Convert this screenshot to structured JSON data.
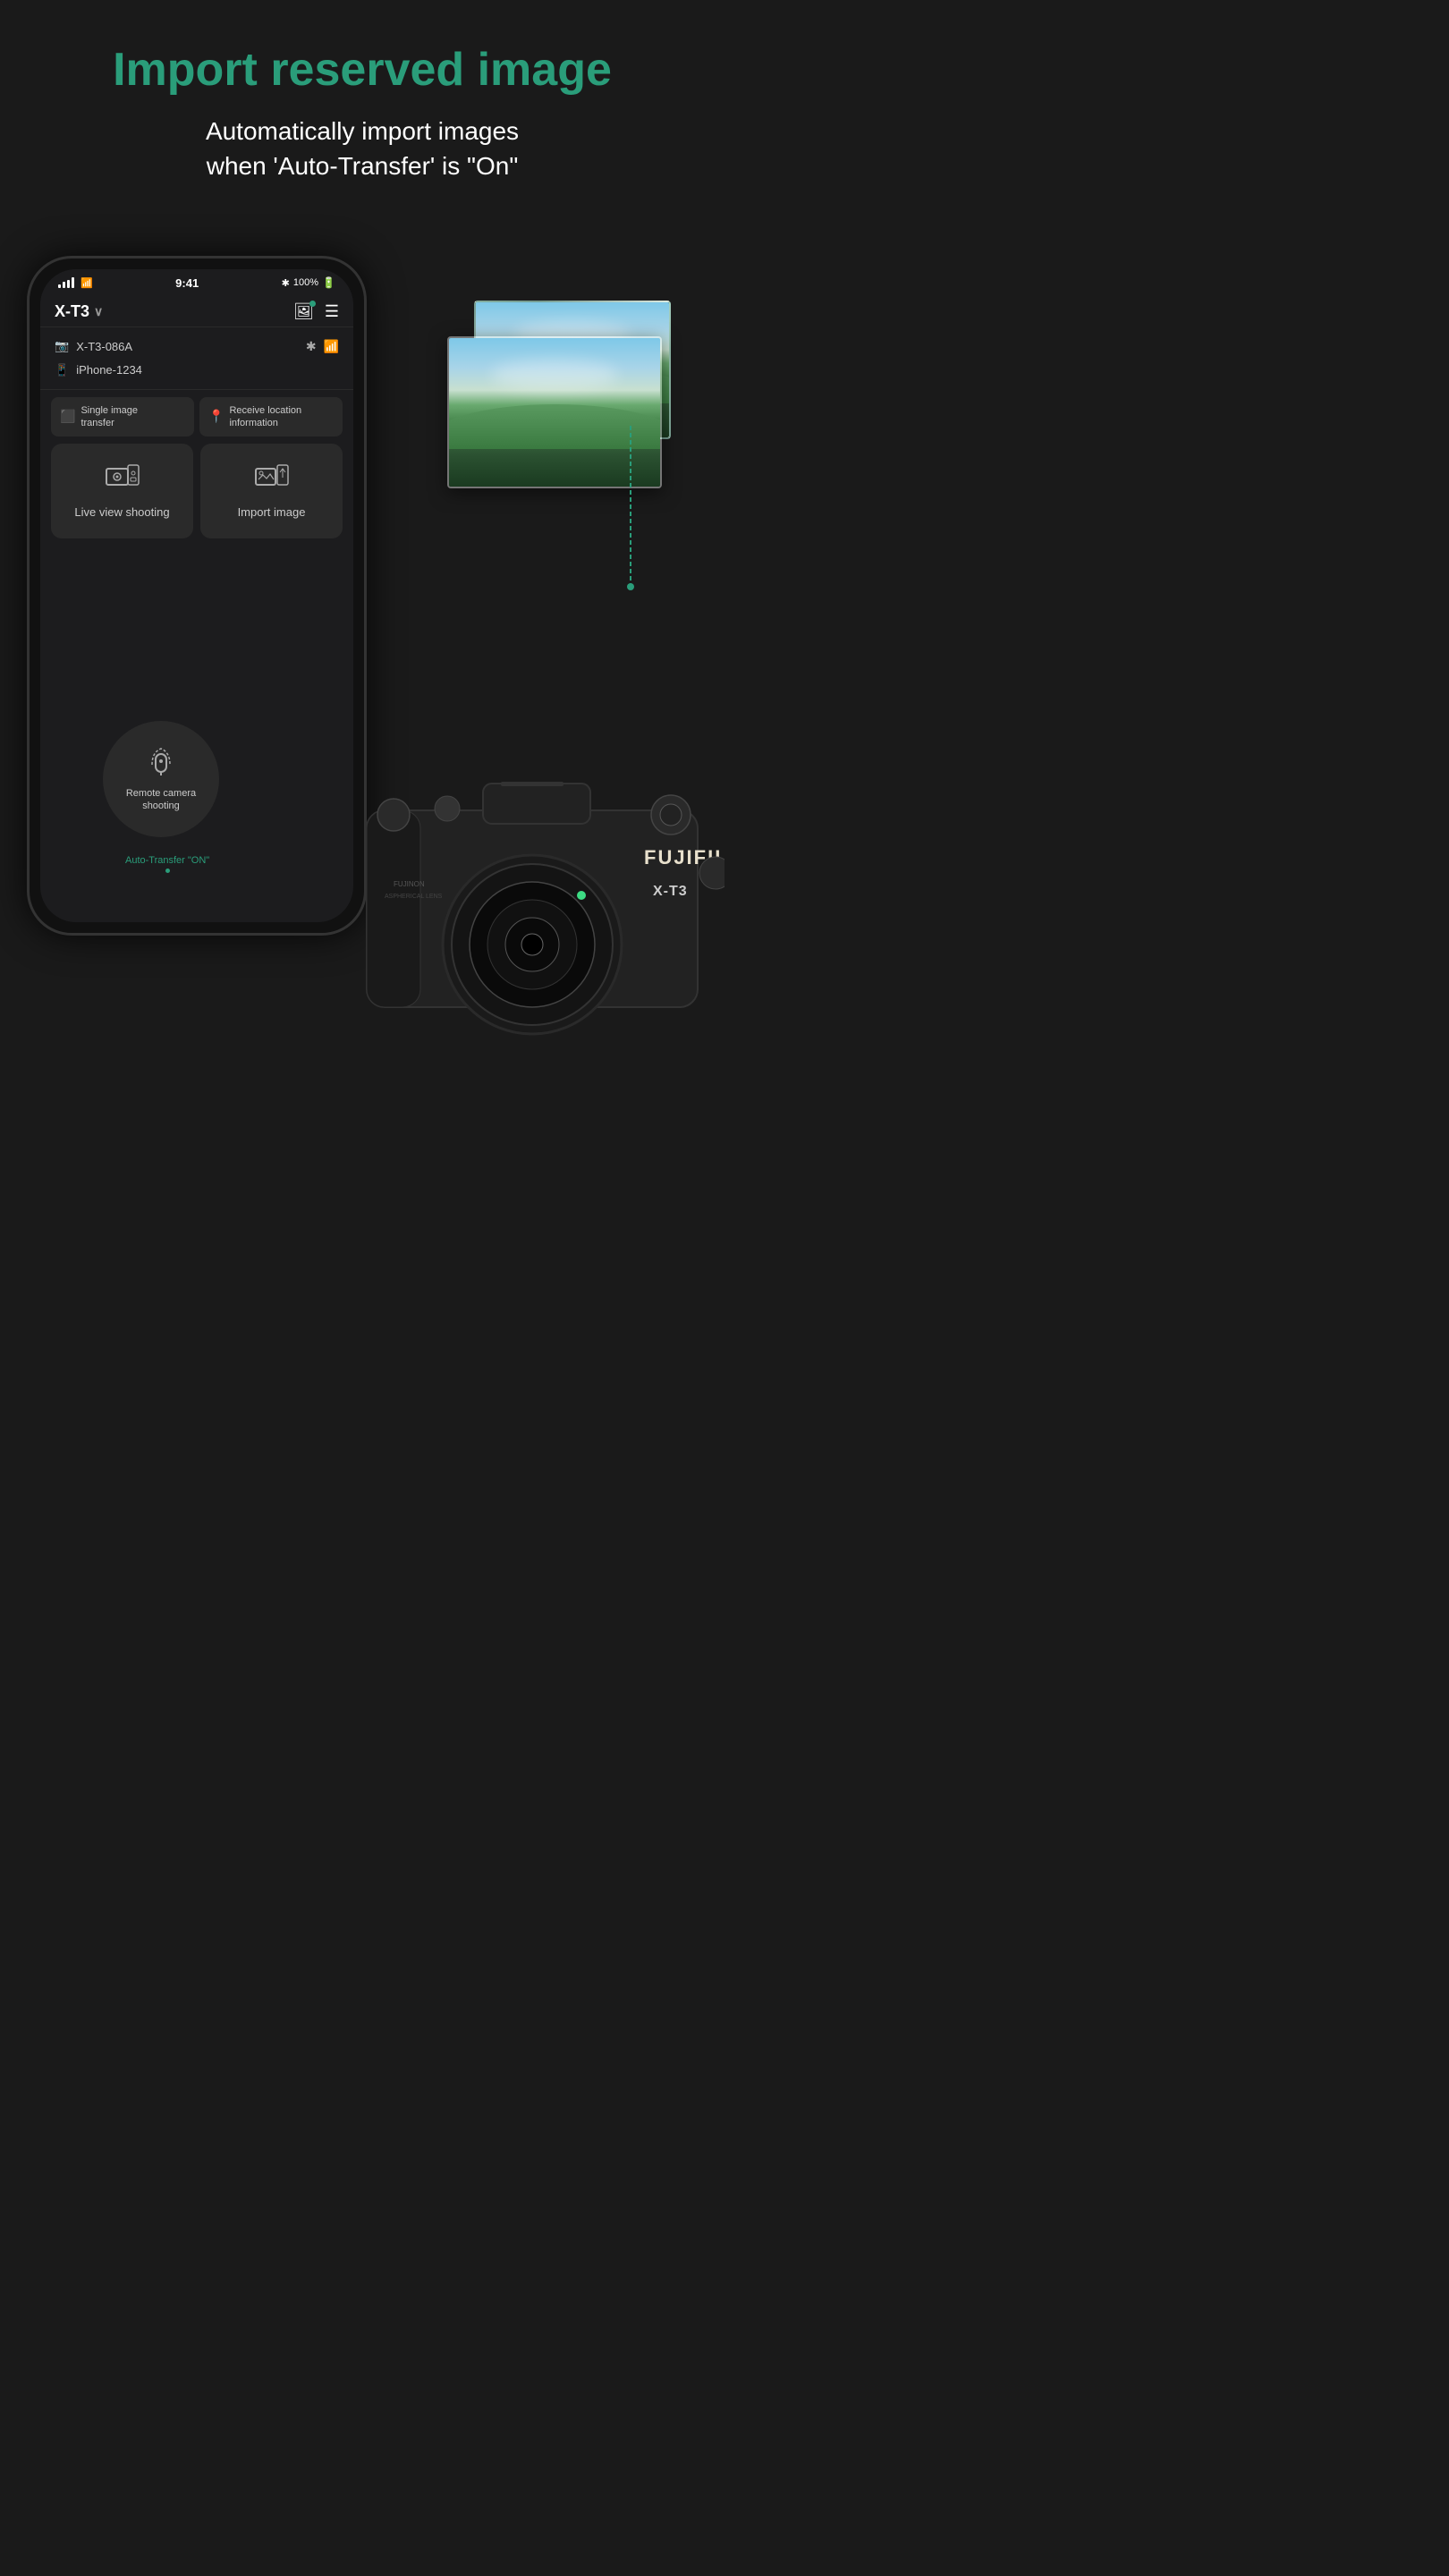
{
  "header": {
    "title": "Import reserved image",
    "subtitle_line1": "Automatically import images",
    "subtitle_line2": "when 'Auto-Transfer' is \"On\""
  },
  "phone": {
    "status_bar": {
      "time": "9:41",
      "battery": "100%",
      "bluetooth": "✱"
    },
    "app_header": {
      "camera_model": "X-T3",
      "chevron": "∨"
    },
    "devices": [
      {
        "icon": "📷",
        "name": "X-T3-086A"
      },
      {
        "icon": "📱",
        "name": "iPhone-1234"
      }
    ],
    "function_buttons": [
      {
        "icon": "⬜",
        "label_line1": "Single image",
        "label_line2": "transfer"
      },
      {
        "icon": "📍",
        "label_line1": "Receive location",
        "label_line2": "information"
      }
    ],
    "menu_items": [
      {
        "label": "Live view shooting"
      },
      {
        "label": "Import image"
      }
    ],
    "remote_camera": {
      "label_line1": "Remote camera",
      "label_line2": "shooting"
    },
    "auto_transfer": "Auto-Transfer \"ON\""
  },
  "camera": {
    "brand": "FUJIFILM",
    "model": "X-T3"
  }
}
